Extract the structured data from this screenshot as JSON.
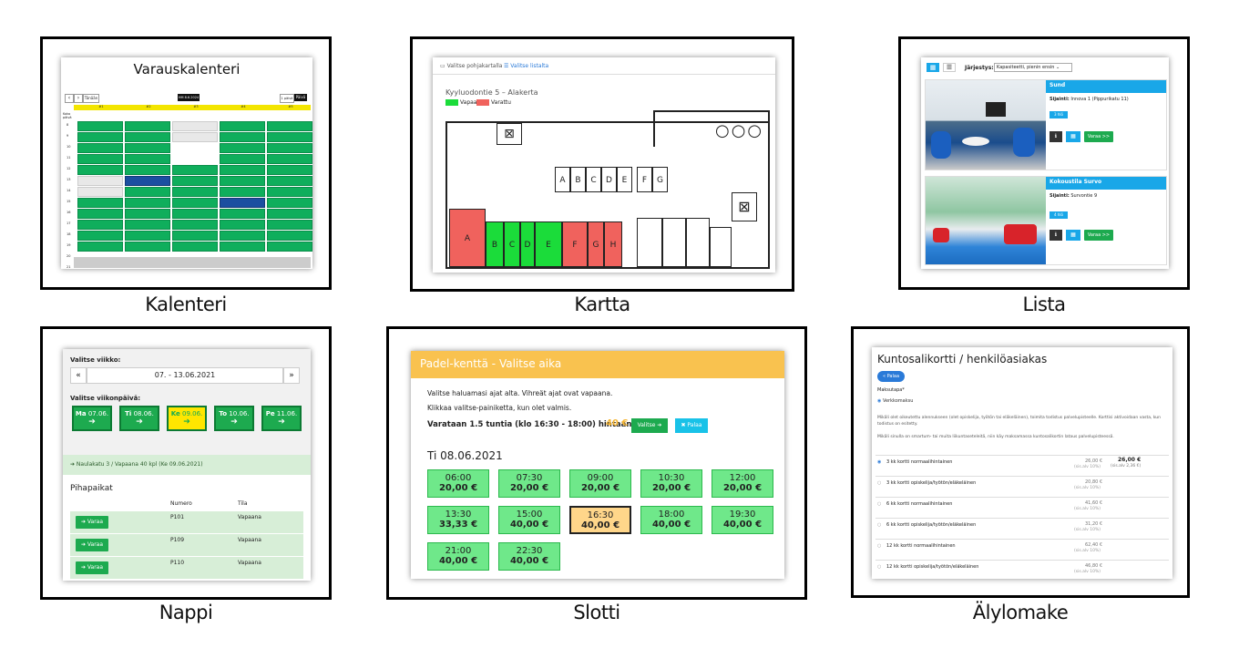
{
  "captions": [
    "Kalenteri",
    "Kartta",
    "Lista",
    "Nappi",
    "Slotti",
    "Älylomake"
  ],
  "kalenteri": {
    "title": "Varauskalenteri",
    "prev": "‹",
    "next": "›",
    "today": "Tänään",
    "date": "HM 8.6.2024",
    "period": "1 päivä",
    "view": "Päivä",
    "rooms": [
      "#1",
      "#2",
      "#3",
      "#4",
      "#5"
    ],
    "hours": [
      "8",
      "9",
      "10",
      "11",
      "12",
      "13",
      "14",
      "15",
      "16",
      "17",
      "18",
      "19",
      "20",
      "21"
    ],
    "side_label": "Koko päivä"
  },
  "kartta": {
    "tab1": "Valitse pohjakartalla",
    "tab2": "Valitse listalta",
    "floor": "Kyyluodontie 5 – Alakerta",
    "legend_free": "Vapaa",
    "legend_taken": "Varattu",
    "rooms_bottom": [
      "A",
      "B",
      "C",
      "D",
      "E",
      "F",
      "G",
      "H"
    ],
    "rooms_top": [
      "A",
      "B",
      "C",
      "D",
      "E",
      "F",
      "G"
    ],
    "colors": {
      "free": "#1bdc3a",
      "taken": "#f0625d"
    }
  },
  "lista": {
    "sort_label": "Järjestys:",
    "sort_value": "Kapasiteetti, pienin ensin",
    "cards": [
      {
        "name": "Sund",
        "location_label": "Sijainti:",
        "location": "Innova 1 (Pippurikatu 11)",
        "capacity": "3 hlö",
        "book": "Varaa >>"
      },
      {
        "name": "Kokoustila Survo",
        "location_label": "Sijainti:",
        "location": "Survontie 9",
        "capacity": "4 hlö",
        "book": "Varaa >>"
      }
    ]
  },
  "nappi": {
    "week_label": "Valitse viikko:",
    "week": "07. - 13.06.2021",
    "prev": "«",
    "next": "»",
    "day_label": "Valitse viikonpäivä:",
    "days": [
      {
        "d": "Ma",
        "date": "07.06."
      },
      {
        "d": "Ti",
        "date": "08.06."
      },
      {
        "d": "Ke",
        "date": "09.06."
      },
      {
        "d": "To",
        "date": "10.06."
      },
      {
        "d": "Pe",
        "date": "11.06."
      }
    ],
    "info": "➔ Naulakatu 3 / Vapaana 40 kpl (Ke 09.06.2021)",
    "section": "Pihapaikat",
    "col_num": "Numero",
    "col_state": "Tila",
    "rows": [
      {
        "btn": "➔ Varaa",
        "num": "P101",
        "state": "Vapaana"
      },
      {
        "btn": "➔ Varaa",
        "num": "P109",
        "state": "Vapaana"
      },
      {
        "btn": "➔ Varaa",
        "num": "P110",
        "state": "Vapaana"
      }
    ]
  },
  "slotti": {
    "title": "Padel-kenttä - Valitse aika",
    "line1": "Valitse haluamasi ajat alta. Vihreät ajat ovat vapaana.",
    "line2": "Klikkaa valitse-painiketta, kun olet valmis.",
    "summary": "Varataan 1.5 tuntia (klo 16:30 - 18:00) hintaan",
    "price": "40 €",
    "choose": "Valitse ➔",
    "back": "✖ Palaa",
    "date": "Ti 08.06.2021",
    "slots": [
      {
        "t": "06:00",
        "p": "20,00 €"
      },
      {
        "t": "07:30",
        "p": "20,00 €"
      },
      {
        "t": "09:00",
        "p": "20,00 €"
      },
      {
        "t": "10:30",
        "p": "20,00 €"
      },
      {
        "t": "12:00",
        "p": "20,00 €"
      },
      {
        "t": "13:30",
        "p": "33,33 €"
      },
      {
        "t": "15:00",
        "p": "40,00 €"
      },
      {
        "t": "16:30",
        "p": "40,00 €"
      },
      {
        "t": "18:00",
        "p": "40,00 €"
      },
      {
        "t": "19:30",
        "p": "40,00 €"
      },
      {
        "t": "21:00",
        "p": "40,00 €"
      },
      {
        "t": "22:30",
        "p": "40,00 €"
      }
    ]
  },
  "alylomake": {
    "title": "Kuntosalikortti / henkilöasiakas",
    "back": "« Palaa",
    "pay_label": "Maksutapa*",
    "pay_option": "Verkkomaksu",
    "note1": "Mikäli olet oikeutettu alennukseen (olet opiskelija, työtön tai eläkeläinen), toimita todistus palvelupisteelle. Korttisi aktivoidaan vasta, kun todistus on esitetty.",
    "note2": "Mikäli sinulla on smartum- tai muita liikuntaseteleitä, niin käy maksamassa kuntosalikortin lataus palvelupisteessä.",
    "vat": "(sis.alv 10%)",
    "total": "26,00 €",
    "total_vat": "(sis.alv 2,36 €)",
    "options": [
      {
        "name": "3 kk kortti normaalihintainen",
        "price": "26,00 €"
      },
      {
        "name": "3 kk kortti opiskelija/työtön/eläkeläinen",
        "price": "20,80 €"
      },
      {
        "name": "6 kk kortti normaalihintainen",
        "price": "41,60 €"
      },
      {
        "name": "6 kk kortti opiskelija/työtön/eläkeläinen",
        "price": "31,20 €"
      },
      {
        "name": "12 kk kortti normaalihintainen",
        "price": "62,40 €"
      },
      {
        "name": "12 kk kortti opiskelija/työtön/eläkeläinen",
        "price": "46,80 €"
      }
    ]
  }
}
